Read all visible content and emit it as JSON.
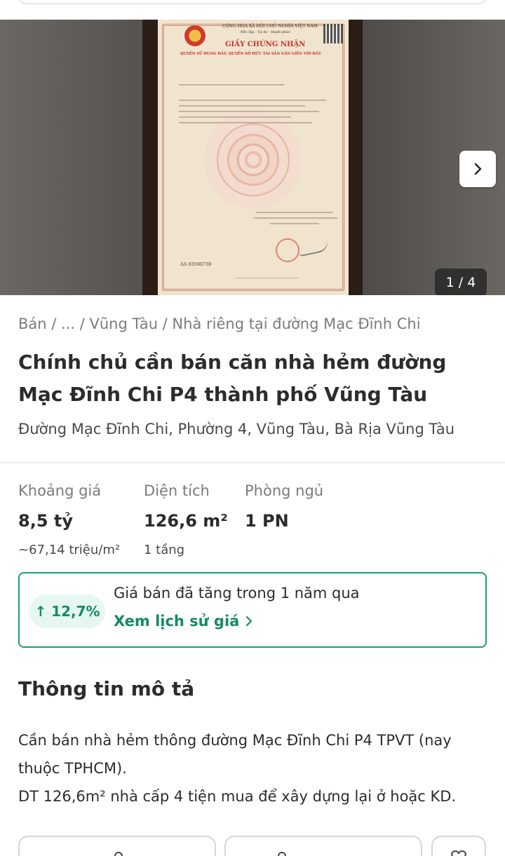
{
  "gallery": {
    "counter": "1 / 4",
    "document": {
      "header_line1": "CỘNG HÒA XÃ HỘI CHỦ NGHĨA VIỆT NAM",
      "header_line2": "Độc lập - Tự do - Hạnh phúc",
      "title": "GIẤY CHỨNG NHẬN",
      "subtitle": "QUYỀN SỬ DỤNG ĐẤT, QUYỀN SỞ HỮU TÀI SẢN GẮN LIỀN VỚI ĐẤT",
      "serial": "AA 03590730"
    }
  },
  "breadcrumb": "Bán / ... / Vũng Tàu / Nhà riêng tại đường Mạc Đĩnh Chi",
  "title": "Chính chủ cần bán căn nhà hẻm đường Mạc Đĩnh Chi P4 thành phố Vũng Tàu",
  "address": "Đường Mạc Đĩnh Chi, Phường 4, Vũng Tàu, Bà Rịa Vũng Tàu",
  "stats": {
    "price": {
      "label": "Khoảng giá",
      "value": "8,5 tỷ",
      "sub": "~67,14 triệu/m²"
    },
    "area": {
      "label": "Diện tích",
      "value": "126,6 m²",
      "sub": "1 tầng"
    },
    "bedrooms": {
      "label": "Phòng ngủ",
      "value": "1 PN"
    }
  },
  "price_trend": {
    "badge": "↑ 12,7%",
    "text": "Giá bán đã tăng trong 1 năm qua",
    "link": "Xem lịch sử giá"
  },
  "description": {
    "heading": "Thông tin mô tả",
    "line1": "Cần bán nhà hẻm thông đường Mạc Đĩnh Chi P4 TPVT (nay thuộc TPHCM).",
    "line2": "DT 126,6m² nhà cấp 4 tiện mua để xây dựng lại ở hoặc KD."
  },
  "colors": {
    "accent": "#1a9e77",
    "accent_text": "#168a63",
    "badge_bg": "#e6f7ef"
  },
  "icons": [
    "chevron-right-icon",
    "chevron-right-small-icon",
    "user-icon",
    "phone-icon",
    "heart-icon"
  ]
}
